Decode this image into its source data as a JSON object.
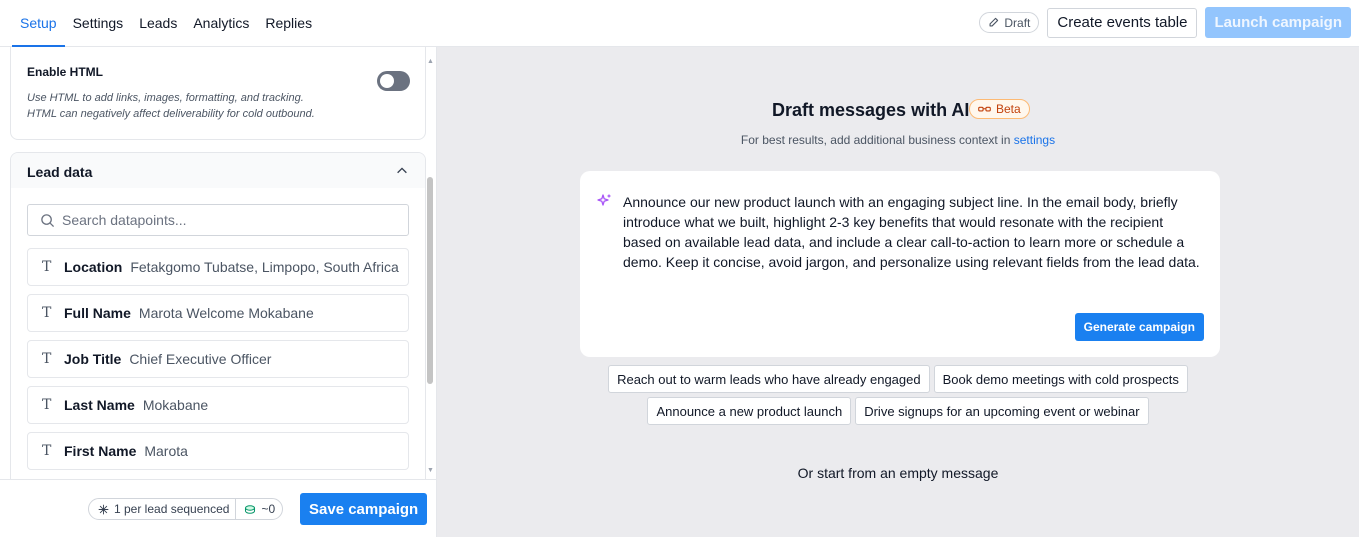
{
  "header": {
    "tabs": [
      {
        "label": "Setup",
        "active": true
      },
      {
        "label": "Settings"
      },
      {
        "label": "Leads"
      },
      {
        "label": "Analytics"
      },
      {
        "label": "Replies"
      }
    ],
    "draft_label": "Draft",
    "create_events_label": "Create events table",
    "launch_label": "Launch campaign"
  },
  "html_card": {
    "title": "Enable HTML",
    "desc_line1": "Use HTML to add links, images, formatting, and tracking.",
    "desc_line2": "HTML can negatively affect deliverability for cold outbound.",
    "enabled": false
  },
  "lead_data": {
    "title": "Lead data",
    "search_placeholder": "Search datapoints...",
    "datapoints": [
      {
        "key": "Location",
        "value": "Fetakgomo Tubatse, Limpopo, South Africa"
      },
      {
        "key": "Full Name",
        "value": "Marota Welcome Mokabane"
      },
      {
        "key": "Job Title",
        "value": "Chief Executive Officer"
      },
      {
        "key": "Last Name",
        "value": "Mokabane"
      },
      {
        "key": "First Name",
        "value": "Marota"
      }
    ]
  },
  "footer": {
    "sequence_label": "1 per lead sequenced",
    "credits_label": "~0",
    "save_label": "Save campaign"
  },
  "ai": {
    "title": "Draft messages with AI",
    "beta_label": "Beta",
    "hint_prefix": "For best results, add additional business context in",
    "hint_link": "settings",
    "prompt": "Announce our new product launch with an engaging subject line. In the email body, briefly introduce what we built, highlight 2-3 key benefits that would resonate with the recipient based on available lead data, and include a clear call-to-action to learn more or schedule a demo. Keep it concise, avoid jargon, and personalize using relevant fields from the lead data.",
    "generate_label": "Generate campaign",
    "suggestions_row1": [
      "Reach out to warm leads who have already engaged",
      "Book demo meetings with cold prospects"
    ],
    "suggestions_row2": [
      "Announce a new product launch",
      "Drive signups for an upcoming event or webinar"
    ],
    "empty_label": "Or start from an empty message"
  },
  "colors": {
    "accent": "#1a80f0",
    "launch_disabled": "#93c5fd",
    "sparkle": "#a855f7",
    "beta": "#c2410c"
  }
}
